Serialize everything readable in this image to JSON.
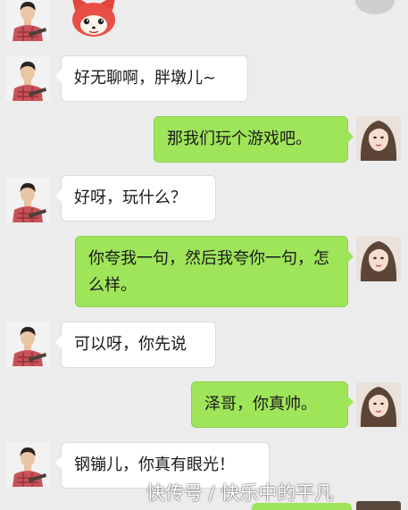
{
  "colors": {
    "background": "#ececec",
    "incoming_bubble": "#ffffff",
    "outgoing_bubble": "#9fe55a"
  },
  "messages": [
    {
      "sender": "male",
      "text": "好无聊啊，胖墩儿~"
    },
    {
      "sender": "female",
      "text": "那我们玩个游戏吧。"
    },
    {
      "sender": "male",
      "text": "好呀，玩什么？"
    },
    {
      "sender": "female",
      "text": "你夸我一句，然后我夸你一句，怎么样。"
    },
    {
      "sender": "male",
      "text": "可以呀，你先说"
    },
    {
      "sender": "female",
      "text": "泽哥，你真帅。"
    },
    {
      "sender": "male",
      "text": "钢镚儿，你真有眼光！"
    }
  ],
  "icons": {
    "sticker": "cartoon-fox-sticker-icon",
    "male_avatar": "male-avatar-icon",
    "female_avatar": "female-avatar-icon"
  },
  "watermark": "快传号 / 快乐中的平凡"
}
